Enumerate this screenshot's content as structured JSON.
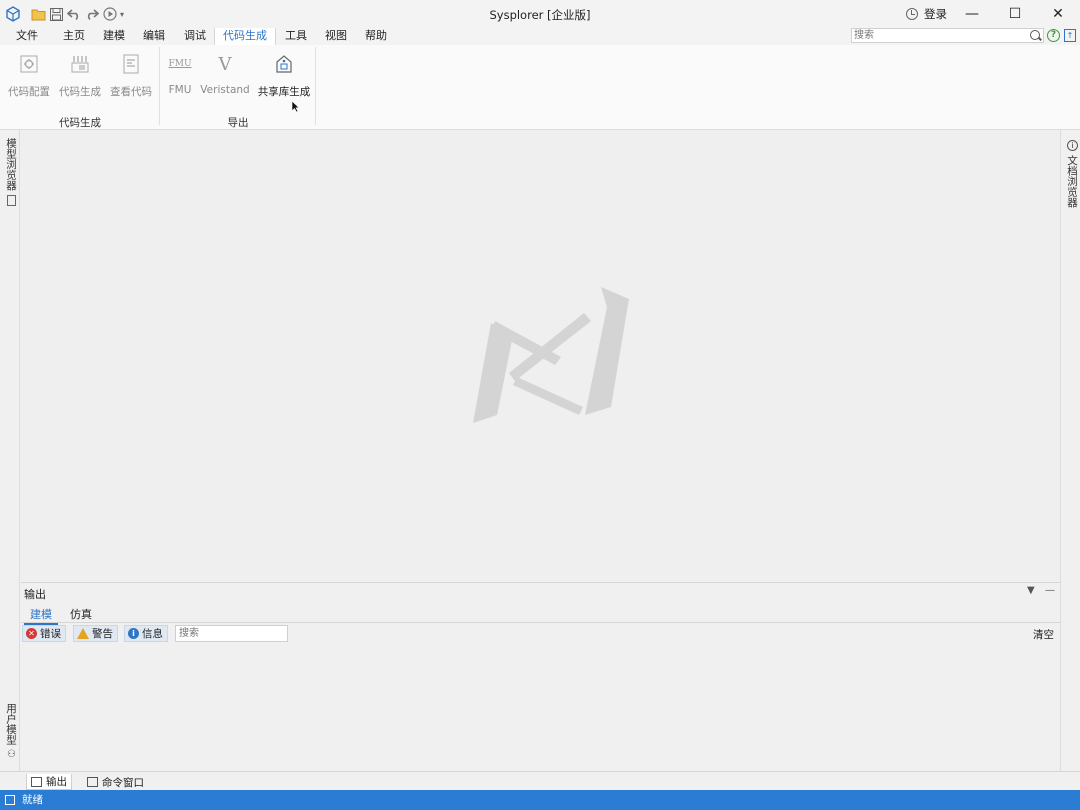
{
  "window": {
    "title": "Sysplorer [企业版]",
    "login_label": "登录",
    "minimize_glyph": "—",
    "maximize_glyph": "☐",
    "close_glyph": "✕"
  },
  "menu": {
    "items": [
      "文件",
      "主页",
      "建模",
      "编辑",
      "调试",
      "代码生成",
      "工具",
      "视图",
      "帮助"
    ],
    "active": "代码生成",
    "search_placeholder": "搜索"
  },
  "ribbon": {
    "groups": [
      {
        "label": "代码生成",
        "buttons": [
          {
            "label": "代码配置",
            "icon": "code-config-icon",
            "enabled": false
          },
          {
            "label": "代码生成",
            "icon": "code-generate-icon",
            "enabled": false
          },
          {
            "label": "查看代码",
            "icon": "view-code-icon",
            "enabled": false
          }
        ]
      },
      {
        "label": "导出",
        "buttons": [
          {
            "label": "FMU",
            "icon": "fmu-icon",
            "enabled": false
          },
          {
            "label": "Veristand",
            "icon": "veristand-icon",
            "enabled": false
          },
          {
            "label": "共享库生成",
            "icon": "shared-library-icon",
            "enabled": true
          }
        ]
      }
    ],
    "fmu_icon_text": "FMU",
    "veristand_icon_text": "V"
  },
  "side_panels": {
    "left_top": "模型浏览器",
    "left_bottom": "用户模型",
    "right_top": "文档浏览器"
  },
  "output": {
    "title": "输出",
    "tabs": [
      "建模",
      "仿真"
    ],
    "active_tab": "建模",
    "filters": [
      {
        "label": "错误",
        "icon": "error-icon"
      },
      {
        "label": "警告",
        "icon": "warning-icon"
      },
      {
        "label": "信息",
        "icon": "info-icon"
      }
    ],
    "search_placeholder": "搜索",
    "clear_label": "清空"
  },
  "bottom_tabs": [
    "输出",
    "命令窗口"
  ],
  "status": {
    "text": "就绪"
  },
  "colors": {
    "accent": "#2e75c7",
    "status_bar": "#2b7cd3",
    "error": "#d93636",
    "warning": "#e5a320"
  }
}
